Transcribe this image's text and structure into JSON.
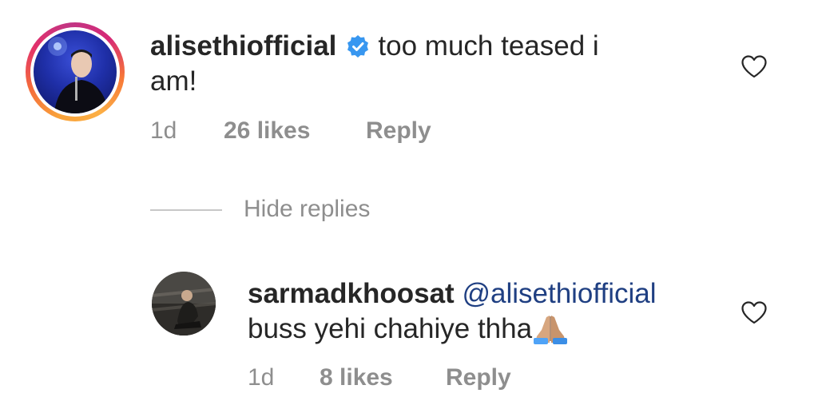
{
  "comments": [
    {
      "username": "alisethiofficial",
      "verified": true,
      "text_line1": "too much teased i",
      "text_line2": "am!",
      "time": "1d",
      "likes": "26 likes",
      "reply_label": "Reply",
      "avatar_ring_colors": [
        "#f9a23a",
        "#e1306c",
        "#c13584"
      ]
    }
  ],
  "hide_replies_label": "Hide replies",
  "replies": [
    {
      "username": "sarmadkhoosat",
      "mention": "@alisethiofficial",
      "text": "buss yehi chahiye thha",
      "emoji": "folded-hands-icon",
      "time": "1d",
      "likes": "8 likes",
      "reply_label": "Reply"
    }
  ],
  "colors": {
    "text": "#262626",
    "muted": "#8e8e8e",
    "mention": "#1f3f82",
    "verified": "#3897f0"
  }
}
